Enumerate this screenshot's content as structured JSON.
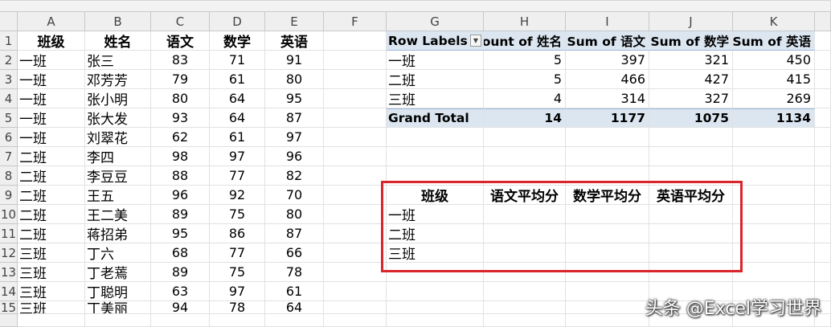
{
  "columns": [
    "A",
    "B",
    "C",
    "D",
    "E",
    "F",
    "G",
    "H",
    "I",
    "J",
    "K"
  ],
  "rows": [
    "1",
    "2",
    "3",
    "4",
    "5",
    "6",
    "7",
    "8",
    "9",
    "10",
    "11",
    "12",
    "13",
    "14",
    "15"
  ],
  "source_table": {
    "headers": [
      "班级",
      "姓名",
      "语文",
      "数学",
      "英语"
    ],
    "rows": [
      [
        "一班",
        "张三",
        "83",
        "71",
        "91"
      ],
      [
        "一班",
        "邓芳芳",
        "79",
        "61",
        "80"
      ],
      [
        "一班",
        "张小明",
        "80",
        "64",
        "95"
      ],
      [
        "一班",
        "张大发",
        "93",
        "64",
        "87"
      ],
      [
        "一班",
        "刘翠花",
        "62",
        "61",
        "97"
      ],
      [
        "二班",
        "李四",
        "98",
        "97",
        "96"
      ],
      [
        "二班",
        "李豆豆",
        "88",
        "77",
        "82"
      ],
      [
        "二班",
        "王五",
        "96",
        "92",
        "70"
      ],
      [
        "二班",
        "王二美",
        "89",
        "75",
        "80"
      ],
      [
        "二班",
        "蒋招弟",
        "95",
        "86",
        "87"
      ],
      [
        "三班",
        "丁六",
        "68",
        "77",
        "66"
      ],
      [
        "三班",
        "丁老蔫",
        "89",
        "75",
        "78"
      ],
      [
        "三班",
        "丁聪明",
        "63",
        "97",
        "61"
      ],
      [
        "三班",
        "丁美丽",
        "94",
        "78",
        "64"
      ]
    ]
  },
  "pivot": {
    "headers": [
      "Row Labels",
      "Count of 姓名",
      "Sum of 语文",
      "Sum of 数学",
      "Sum of 英语"
    ],
    "rows": [
      [
        "一班",
        "5",
        "397",
        "321",
        "450"
      ],
      [
        "二班",
        "5",
        "466",
        "427",
        "415"
      ],
      [
        "三班",
        "4",
        "314",
        "327",
        "269"
      ]
    ],
    "total": [
      "Grand Total",
      "14",
      "1177",
      "1075",
      "1134"
    ],
    "filter_icon": "dropdown-arrow-icon"
  },
  "summary": {
    "headers": [
      "班级",
      "语文平均分",
      "数学平均分",
      "英语平均分"
    ],
    "rows": [
      "一班",
      "二班",
      "三班"
    ]
  },
  "highlight_color": "#d9252b",
  "watermark": "头条 @Excel学习世界"
}
